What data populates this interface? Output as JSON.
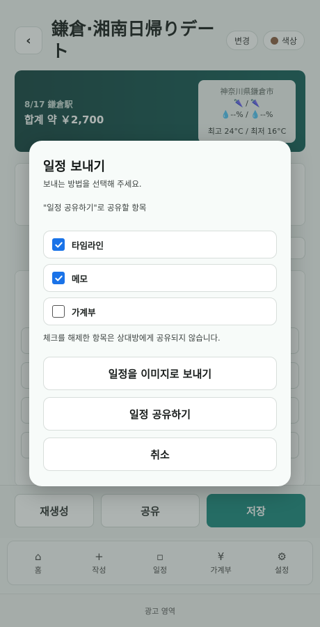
{
  "header": {
    "back_icon": "chevron-left-icon",
    "back_glyph": "‹",
    "title": "鎌倉·湘南日帰りデート",
    "edit_label": "변경",
    "color_label": "색상",
    "color_dot": "#8a5a3e"
  },
  "hero": {
    "date_station": "8/17 鎌倉駅",
    "total": "합계 약 ￥2,700",
    "weather": {
      "place": "神奈川県鎌倉市",
      "umbrella_row": "🌂 / 🌂",
      "rain_row": "💧--% / 💧--%",
      "temps": "최고 24°C / 최저 16°C"
    }
  },
  "action_bar": {
    "regenerate_label": "재생성",
    "share_label": "공유",
    "save_label": "저장"
  },
  "tabbar": {
    "items": [
      {
        "icon": "⌂",
        "label": "홈",
        "icon_name": "home-icon"
      },
      {
        "icon": "+",
        "label": "작성",
        "icon_name": "plus-icon"
      },
      {
        "icon": "▫",
        "label": "일정",
        "icon_name": "calendar-icon"
      },
      {
        "icon": "¥",
        "label": "가계부",
        "icon_name": "yen-icon"
      },
      {
        "icon": "⚙",
        "label": "설정",
        "icon_name": "gear-icon"
      }
    ]
  },
  "ad_label": "광고 영역",
  "modal": {
    "title": "일정 보내기",
    "description": "보내는 방법을 선택해 주세요.",
    "section_label": "\"일정 공유하기\"로 공유할 항목",
    "options": [
      {
        "label": "타임라인",
        "checked": true
      },
      {
        "label": "메모",
        "checked": true
      },
      {
        "label": "가계부",
        "checked": false
      }
    ],
    "note": "체크를 해제한 항목은 상대방에게 공유되지 않습니다.",
    "send_image_label": "일정을 이미지로 보내기",
    "share_schedule_label": "일정 공유하기",
    "cancel_label": "취소",
    "checkbox_color": "#1a73e8"
  }
}
